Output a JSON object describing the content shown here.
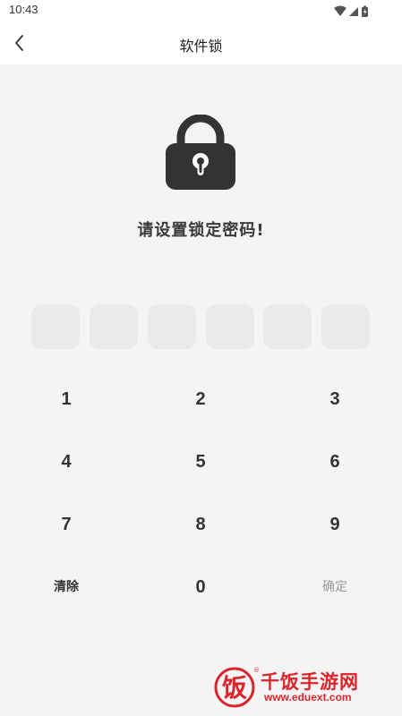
{
  "status_bar": {
    "time": "10:43",
    "icons": [
      "wifi-icon",
      "signal-icon",
      "battery-icon"
    ]
  },
  "header": {
    "back_icon": "chevron-left-icon",
    "title": "软件锁"
  },
  "lock": {
    "icon": "padlock-icon"
  },
  "prompt": "请设置锁定密码!",
  "pin": {
    "length": 6,
    "entered": ""
  },
  "keypad": {
    "keys": [
      "1",
      "2",
      "3",
      "4",
      "5",
      "6",
      "7",
      "8",
      "9"
    ],
    "clear_label": "清除",
    "zero_label": "0",
    "confirm_label": "确定"
  },
  "watermark": {
    "name": "千饭手游网",
    "url": "www.eduext.com",
    "seal_char": "饭"
  },
  "colors": {
    "background": "#f5f4f4",
    "pin_box": "#ebeae9",
    "text": "#333333",
    "confirm_disabled": "#999999",
    "watermark_red": "#d9262c"
  }
}
